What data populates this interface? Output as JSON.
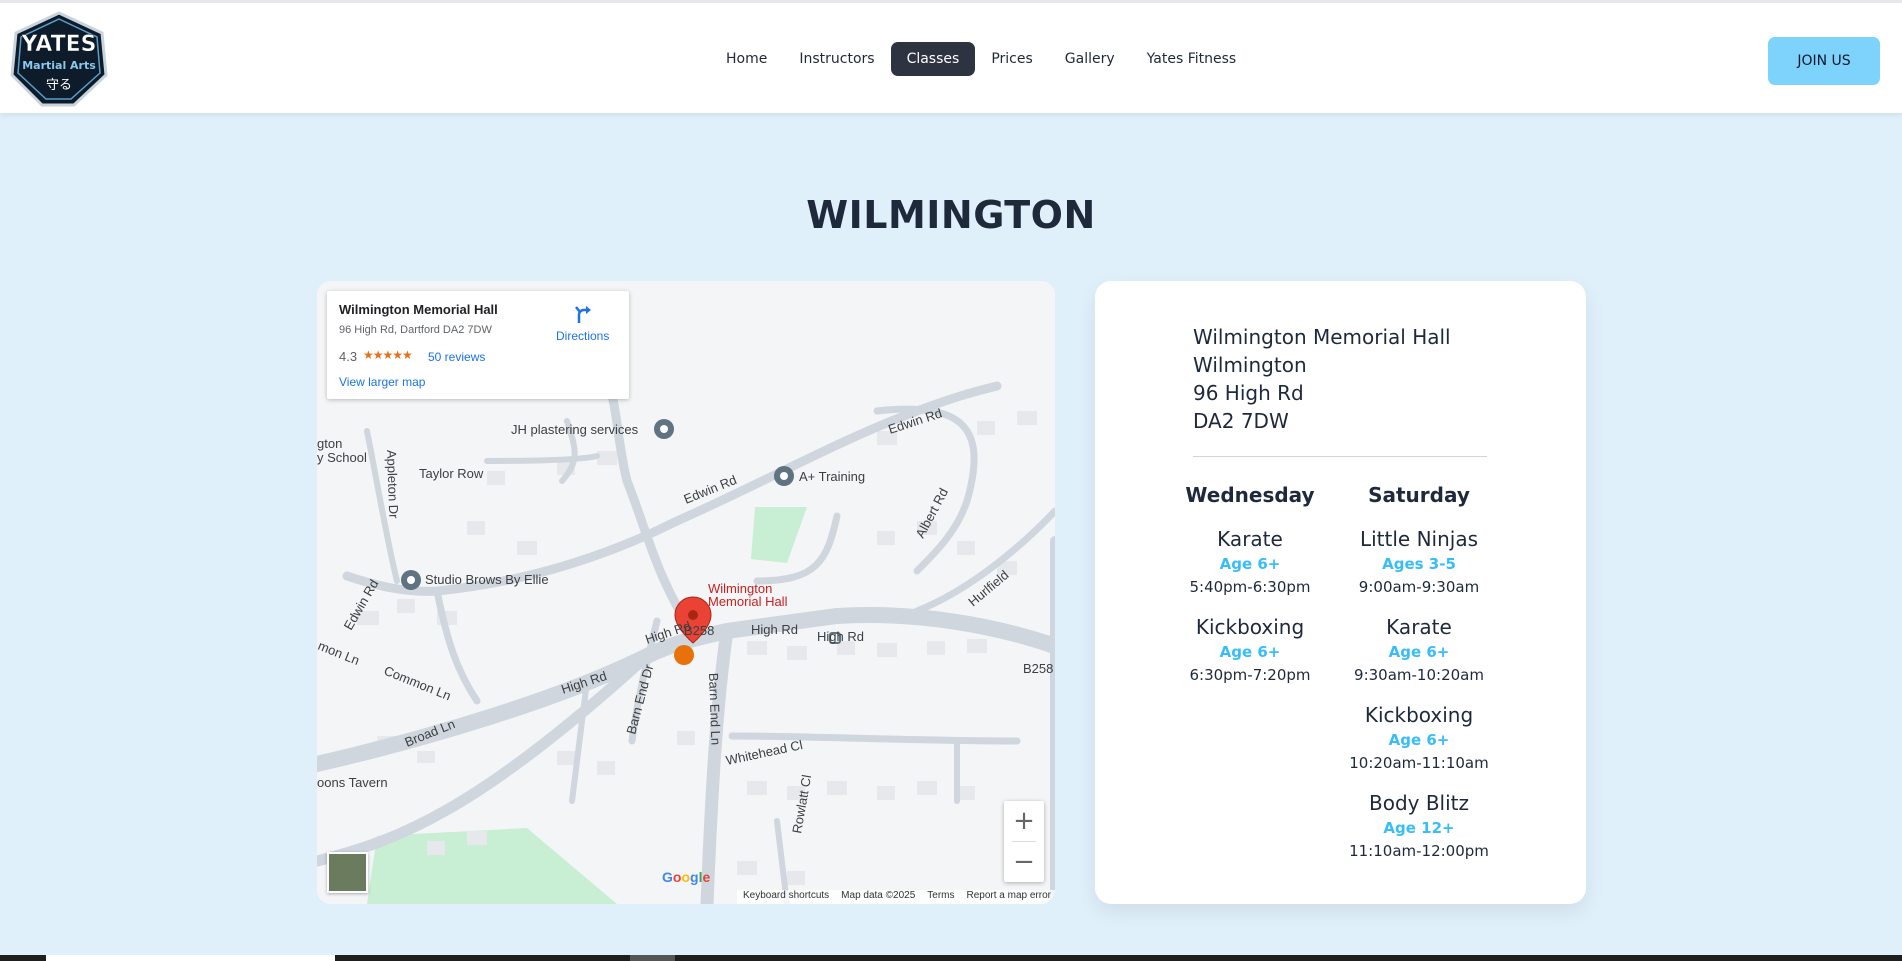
{
  "header": {
    "logo_alt": "Yates Martial Arts",
    "logo_lines": [
      "YATES",
      "Martial Arts",
      "守る"
    ],
    "nav": [
      "Home",
      "Instructors",
      "Classes",
      "Prices",
      "Gallery",
      "Yates Fitness"
    ],
    "active_nav": "Classes",
    "join_label": "JOIN US"
  },
  "page": {
    "title": "WILMINGTON"
  },
  "map": {
    "place_name": "Wilmington Memorial Hall",
    "place_address": "96 High Rd, Dartford DA2 7DW",
    "rating": "4.3",
    "stars": "★★★★★",
    "reviews": "50 reviews",
    "directions": "Directions",
    "view_larger": "View larger map",
    "pin_label": [
      "Wilmington",
      "Memorial Hall"
    ],
    "poi": [
      "JH plastering services",
      "A+ Training",
      "Studio Brows By Ellie"
    ],
    "roads": [
      "Edwin Rd",
      "Taylor Row",
      "Appleton Dr",
      "Albert Rd",
      "Hurlfield",
      "High Rd",
      "B258",
      "Common Ln",
      "Broad Ln",
      "Barn End Dr",
      "Barn End Ln",
      "Whitehead Cl",
      "Rowlatt Cl",
      "gton",
      "y School",
      "oons Tavern",
      "mon Ln"
    ],
    "zoom_in": "+",
    "zoom_out": "−",
    "google": "Google",
    "attribution": [
      "Keyboard shortcuts",
      "Map data ©2025",
      "Terms",
      "Report a map error"
    ]
  },
  "venue": {
    "address_lines": [
      "Wilmington Memorial Hall",
      "Wilmington",
      "96 High Rd",
      "DA2 7DW"
    ]
  },
  "schedule": [
    {
      "day": "Wednesday",
      "classes": [
        {
          "name": "Karate",
          "age": "Age 6+",
          "time": "5:40pm-6:30pm"
        },
        {
          "name": "Kickboxing",
          "age": "Age 6+",
          "time": "6:30pm-7:20pm"
        }
      ]
    },
    {
      "day": "Saturday",
      "classes": [
        {
          "name": "Little Ninjas",
          "age": "Ages 3-5",
          "time": "9:00am-9:30am"
        },
        {
          "name": "Karate",
          "age": "Age 6+",
          "time": "9:30am-10:20am"
        },
        {
          "name": "Kickboxing",
          "age": "Age 6+",
          "time": "10:20am-11:10am"
        },
        {
          "name": "Body Blitz",
          "age": "Age 12+",
          "time": "11:10am-12:00pm"
        }
      ]
    }
  ],
  "colors": {
    "page_bg": "#e0f0fb",
    "accent": "#38bdf8",
    "join_bg": "#7dd3fc",
    "nav_active": "#2d3340"
  }
}
